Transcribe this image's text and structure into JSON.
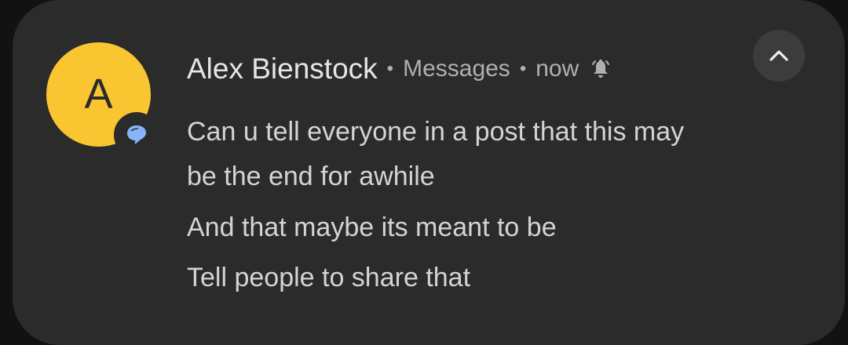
{
  "notification": {
    "avatar_letter": "A",
    "avatar_color": "#f9c531",
    "app_badge_icon": "messages-bubble-icon",
    "badge_color": "#8ab4f8",
    "sender": "Alex Bienstock",
    "separator": "•",
    "app_name": "Messages",
    "time": "now",
    "alert_icon": "bell-ringing-icon",
    "expand_icon": "chevron-up-icon",
    "message_lines": [
      "Can u tell everyone in a post that this may",
      "be the end for awhile",
      "And that maybe its meant to be",
      "Tell people to share that"
    ]
  }
}
